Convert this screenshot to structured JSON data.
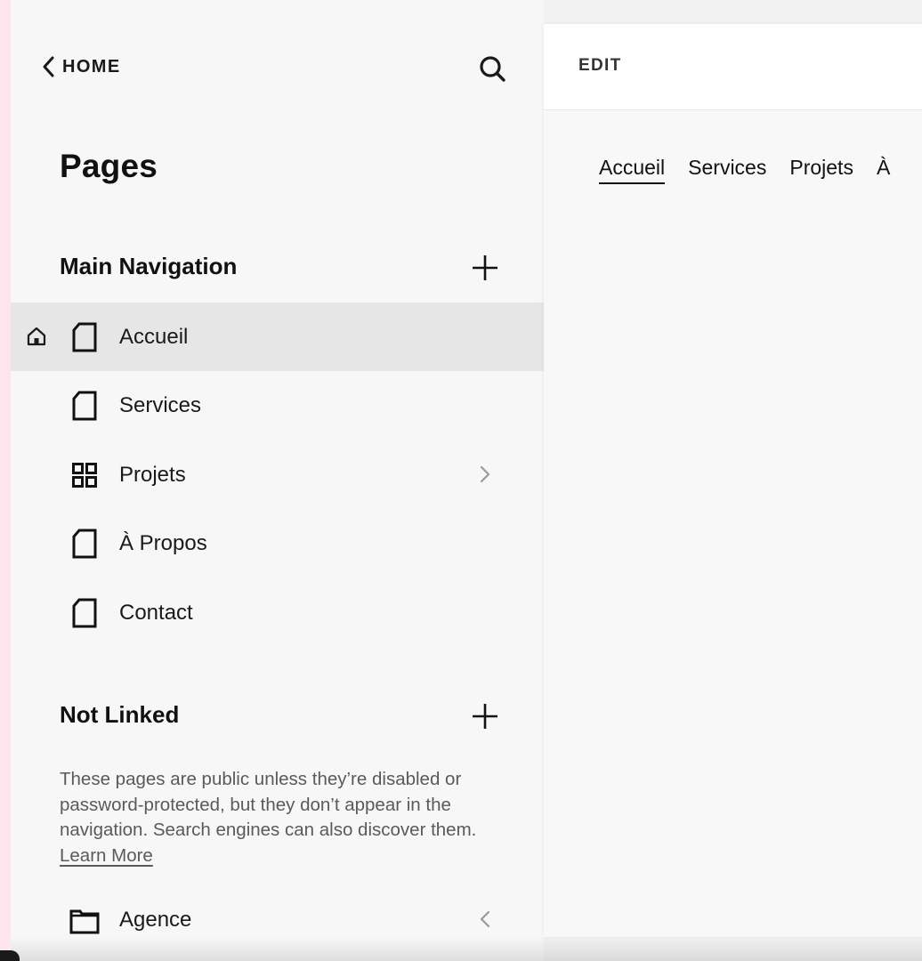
{
  "colors": {
    "sidebar_bg": "#f7f7f7",
    "active_row": "#e6e6e6",
    "left_strip": "#fde4ee"
  },
  "topbar": {
    "back_label": "HOME",
    "back_icon": "chevron-left-icon",
    "search_icon": "search-icon"
  },
  "sidebar": {
    "title": "Pages",
    "main_navigation": {
      "heading": "Main Navigation",
      "add_icon": "plus-icon",
      "items": [
        {
          "label": "Accueil",
          "icon": "page-icon",
          "is_homepage": true,
          "active": true
        },
        {
          "label": "Services",
          "icon": "page-icon"
        },
        {
          "label": "Projets",
          "icon": "grid-icon",
          "chevron": "chevron-right-icon"
        },
        {
          "label": "À Propos",
          "icon": "page-icon"
        },
        {
          "label": "Contact",
          "icon": "page-icon"
        }
      ]
    },
    "not_linked": {
      "heading": "Not Linked",
      "add_icon": "plus-icon",
      "description": "These pages are public unless they’re disabled or password-protected, but they don’t appear in the navigation. Search engines can also discover them.",
      "learn_more": "Learn More",
      "items": [
        {
          "label": "Agence",
          "icon": "folder-icon",
          "chevron": "chevron-left-icon"
        }
      ]
    }
  },
  "preview": {
    "edit_label": "EDIT",
    "site_nav": [
      "Accueil",
      "Services",
      "Projets",
      "À"
    ]
  }
}
